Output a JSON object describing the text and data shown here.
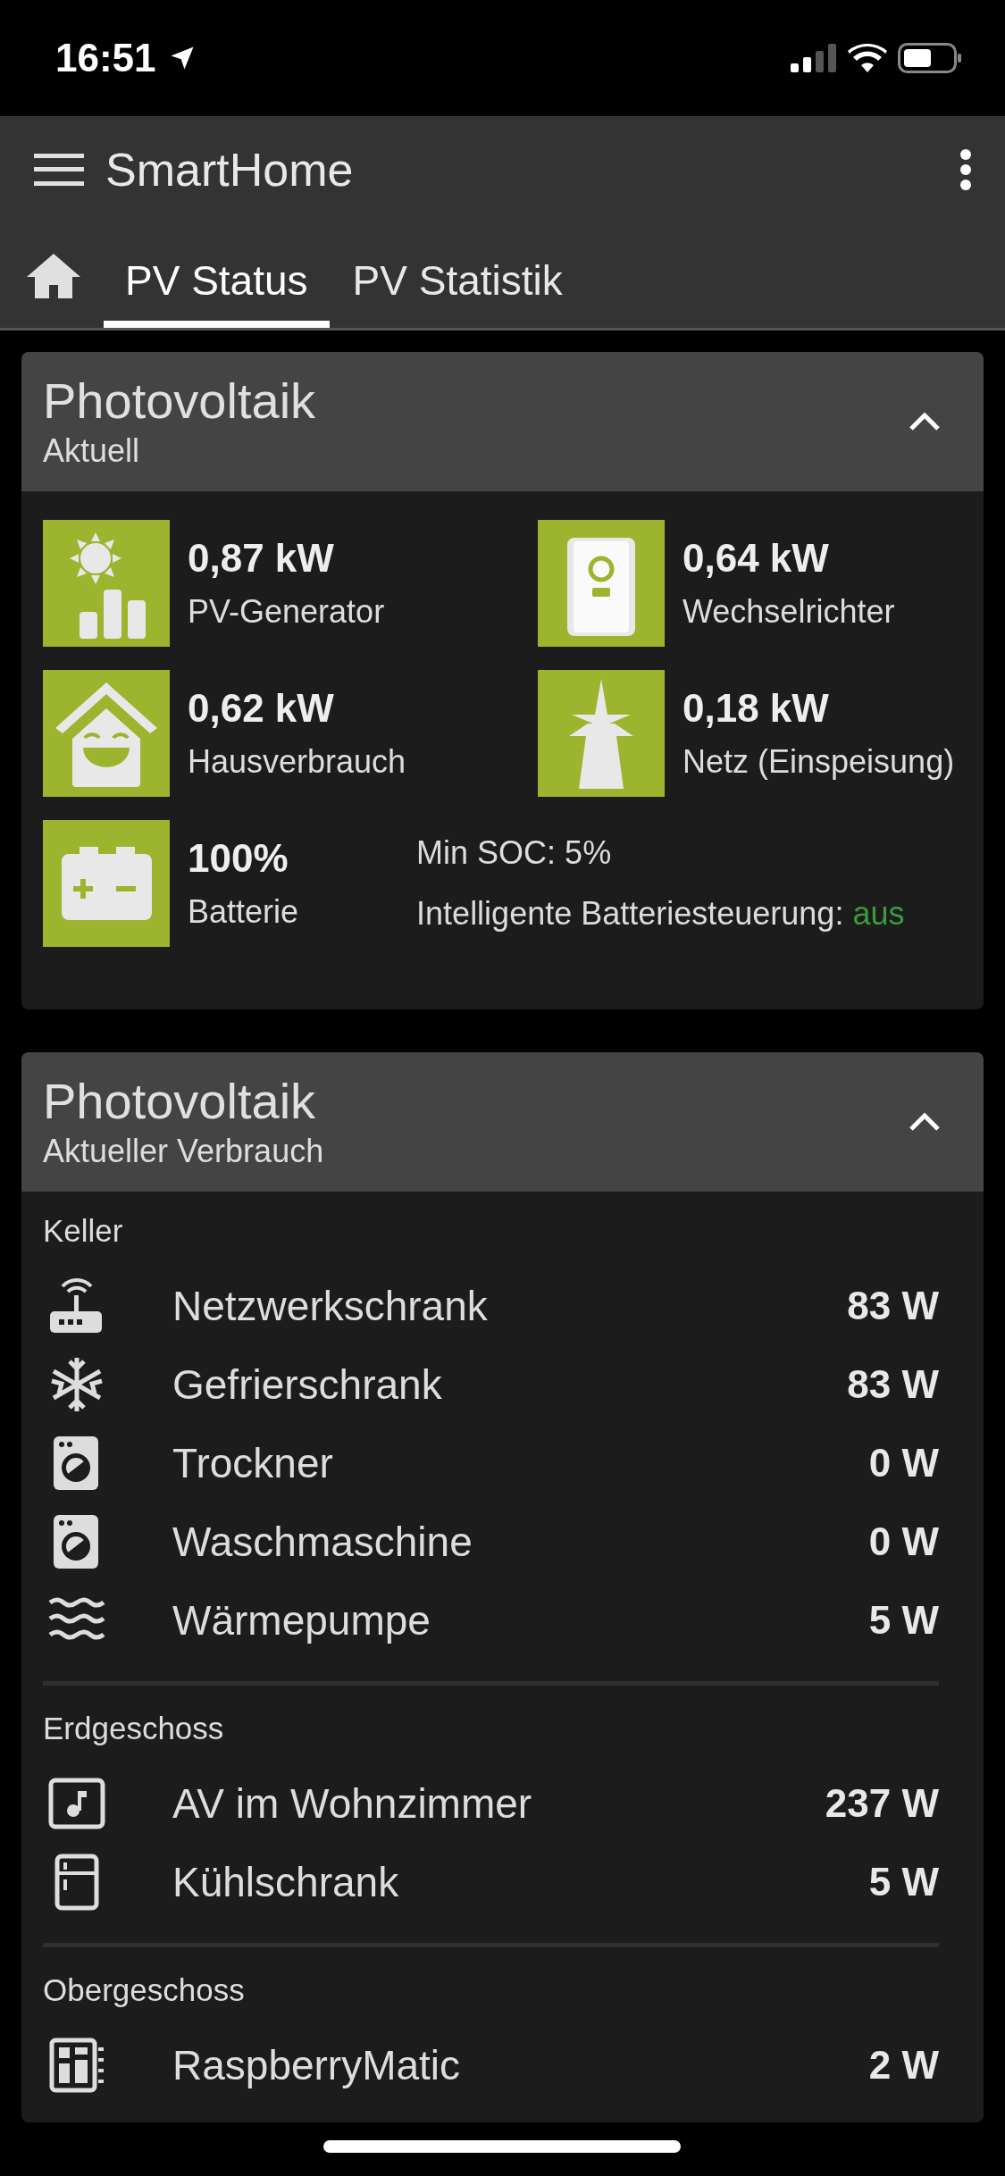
{
  "status_bar": {
    "time": "16:51"
  },
  "app_bar": {
    "title": "SmartHome"
  },
  "tabs": [
    {
      "label": "PV Status",
      "selected": true
    },
    {
      "label": "PV Statistik",
      "selected": false
    }
  ],
  "summary_card": {
    "title": "Photovoltaik",
    "subtitle": "Aktuell",
    "expanded": true,
    "tiles": [
      {
        "kind": "solar",
        "value": "0,87 kW",
        "label": "PV-Generator"
      },
      {
        "kind": "inverter",
        "value": "0,64 kW",
        "label": "Wechselrichter"
      },
      {
        "kind": "house",
        "value": "0,62 kW",
        "label": "Hausverbrauch"
      },
      {
        "kind": "pylon",
        "value": "0,18 kW",
        "label": "Netz (Einspeisung)"
      },
      {
        "kind": "battery",
        "value": "100%",
        "label": "Batterie"
      }
    ],
    "min_soc": "Min SOC: 5%",
    "smart_battery_label": "Intelligente Batteriesteuerung:",
    "smart_battery_value": "aus"
  },
  "consumption_card": {
    "title": "Photovoltaik",
    "subtitle": "Aktueller Verbrauch",
    "expanded": true,
    "groups": [
      {
        "name": "Keller",
        "items": [
          {
            "kind": "router",
            "name": "Netzwerkschrank",
            "value": "83 W"
          },
          {
            "kind": "snowflake",
            "name": "Gefrierschrank",
            "value": "83 W"
          },
          {
            "kind": "washer",
            "name": "Trockner",
            "value": "0 W"
          },
          {
            "kind": "washer",
            "name": "Waschmaschine",
            "value": "0 W"
          },
          {
            "kind": "waves",
            "name": "Wärmepumpe",
            "value": "5 W"
          }
        ]
      },
      {
        "name": "Erdgeschoss",
        "items": [
          {
            "kind": "music",
            "name": "AV im Wohnzimmer",
            "value": "237 W"
          },
          {
            "kind": "fridge",
            "name": "Kühlschrank",
            "value": "5 W"
          }
        ]
      },
      {
        "name": "Obergeschoss",
        "items": [
          {
            "kind": "board",
            "name": "RaspberryMatic",
            "value": "2 W"
          }
        ]
      }
    ]
  }
}
